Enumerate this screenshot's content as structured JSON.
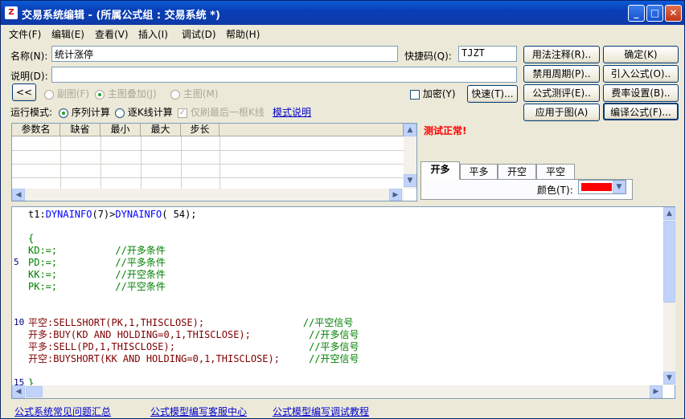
{
  "window": {
    "title": "交易系统编辑 - (所属公式组 : 交易系统 *)",
    "app_icon": "Z"
  },
  "title_buttons": {
    "min": "_",
    "max": "□",
    "close": "✕"
  },
  "menu": [
    "文件(F)",
    "编辑(E)",
    "查看(V)",
    "插入(I)",
    "调试(D)",
    "帮助(H)"
  ],
  "form": {
    "name_label": "名称(N):",
    "name_value": "统计涨停",
    "shortcut_label": "快捷码(Q):",
    "shortcut_value": "TJZT",
    "desc_label": "说明(D):",
    "desc_value": "",
    "collapse_label": "<<",
    "sub_chart": "副图(F)",
    "main_overlay": "主图叠加(J)",
    "main_chart": "主图(M)",
    "encrypt_label": "加密(Y)",
    "fast_label": "快速(T)...",
    "run_mode_label": "运行模式:",
    "seq_calc": "序列计算",
    "bar_calc": "逐K线计算",
    "refresh_last": "仅刷最后一根K线",
    "mode_link": "模式说明"
  },
  "buttons": {
    "usage_note": "用法注释(R)..",
    "confirm": "确定(K)",
    "disable_period": "禁用周期(P)..",
    "import_formula": "引入公式(O)..",
    "test_formula": "公式测评(E)..",
    "fee_setting": "费率设置(B)..",
    "apply_chart": "应用于图(A)",
    "compile": "编译公式(F)..."
  },
  "param_table": {
    "headers": [
      "参数名",
      "缺省",
      "最小",
      "最大",
      "步长"
    ]
  },
  "status": {
    "test_result": "测试正常!",
    "status_color": "#ff0000"
  },
  "signal_tabs": [
    "开多",
    "平多",
    "开空",
    "平空"
  ],
  "color_label": "颜色(T):",
  "color_value": "#ff0000",
  "code_lines": [
    {
      "n": "",
      "t": "t1:DYNAINFO(7)>DYNAINFO( 54);"
    },
    {
      "n": "",
      "t": ""
    },
    {
      "n": "",
      "t": "{"
    },
    {
      "n": "",
      "t": "KD:=;          //开多条件"
    },
    {
      "n": "5",
      "t": "PD:=;          //平多条件"
    },
    {
      "n": "",
      "t": "KK:=;          //开空条件"
    },
    {
      "n": "",
      "t": "PK:=;          //平空条件"
    },
    {
      "n": "",
      "t": ""
    },
    {
      "n": "",
      "t": ""
    },
    {
      "n": "10",
      "t": "平空:SELLSHORT(PK,1,THISCLOSE);                 //平空信号"
    },
    {
      "n": "",
      "t": "开多:BUY(KD AND HOLDING=0,1,THISCLOSE);          //开多信号"
    },
    {
      "n": "",
      "t": "平多:SELL(PD,1,THISCLOSE);                       //平多信号"
    },
    {
      "n": "",
      "t": "开空:BUYSHORT(KK AND HOLDING=0,1,THISCLOSE);     //开空信号"
    },
    {
      "n": "",
      "t": ""
    },
    {
      "n": "15",
      "t": "}"
    }
  ],
  "footer_links": [
    "公式系统常见问题汇总",
    "公式模型编写客服中心",
    "公式模型编写调试教程"
  ]
}
